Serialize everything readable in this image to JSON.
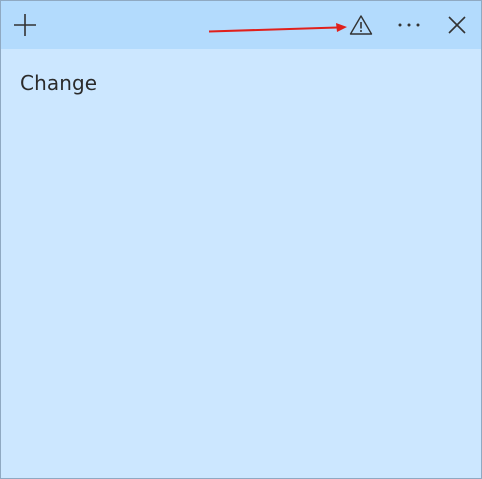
{
  "window": {
    "background": "#cce7ff",
    "titlebar_background": "#b3dbfd",
    "border": "#8fa9c2"
  },
  "titlebar": {
    "buttons": [
      {
        "icon": "plus-icon"
      },
      {
        "icon": "warning-icon"
      },
      {
        "icon": "more-options-icon"
      },
      {
        "icon": "close-icon"
      }
    ]
  },
  "annotation": {
    "color": "#e0201c"
  },
  "note": {
    "text": "Change"
  }
}
